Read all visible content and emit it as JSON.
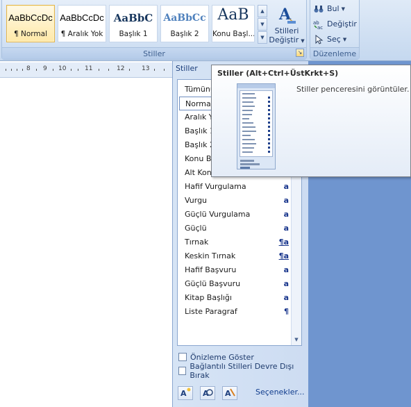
{
  "ribbon": {
    "style_tiles": [
      {
        "sample": "AaBbCcDc",
        "label": "¶ Normal",
        "selected": true
      },
      {
        "sample": "AaBbCcDc",
        "label": "¶ Aralık Yok",
        "selected": false
      },
      {
        "sample": "AaBbC",
        "label": "Başlık 1",
        "selected": false
      },
      {
        "sample": "AaBbCc",
        "label": "Başlık 2",
        "selected": false
      },
      {
        "sample": "AaB",
        "label": "Konu Başl...",
        "selected": false
      }
    ],
    "change_styles_label_1": "Stilleri",
    "change_styles_label_2": "Değiştir",
    "styles_group_label": "Stiller",
    "editing": {
      "find_label": "Bul",
      "replace_label": "Değiştir",
      "select_label": "Seç",
      "group_label": "Düzenleme"
    }
  },
  "ruler": {
    "numbers": [
      "8",
      "9",
      "10",
      "11",
      "12",
      "13"
    ]
  },
  "pane": {
    "title": "Stiller",
    "styles": [
      {
        "name": "Tümünü",
        "mark": ""
      },
      {
        "name": "Normal",
        "mark": "",
        "selected": true
      },
      {
        "name": "Aralık Yo",
        "mark": ""
      },
      {
        "name": "Başlık 1",
        "mark": ""
      },
      {
        "name": "Başlık 2",
        "mark": ""
      },
      {
        "name": "Konu Ba",
        "mark": ""
      },
      {
        "name": "Alt Konu",
        "mark": ""
      },
      {
        "name": "Hafif Vurgulama",
        "mark": "a"
      },
      {
        "name": "Vurgu",
        "mark": "a"
      },
      {
        "name": "Güçlü Vurgulama",
        "mark": "a"
      },
      {
        "name": "Güçlü",
        "mark": "a"
      },
      {
        "name": "Tırnak",
        "mark": "¶a"
      },
      {
        "name": "Keskin Tırnak",
        "mark": "¶a"
      },
      {
        "name": "Hafif Başvuru",
        "mark": "a"
      },
      {
        "name": "Güçlü Başvuru",
        "mark": "a"
      },
      {
        "name": "Kitap Başlığı",
        "mark": "a"
      },
      {
        "name": "Liste Paragraf",
        "mark": "¶"
      }
    ],
    "show_preview_label": "Önizleme Göster",
    "disable_linked_label": "Bağlantılı Stilleri Devre Dışı Bırak",
    "options_label": "Seçenekler..."
  },
  "tooltip": {
    "title": "Stiller (Alt+Ctrl+ÜstKrkt+S)",
    "body": "Stiller penceresini görüntüler."
  },
  "colors": {
    "accent": "#1a3d7a",
    "ribbon_bg": "#d3e2f4",
    "selection": "#ffe9a8",
    "app_bg": "#6f95cf"
  }
}
